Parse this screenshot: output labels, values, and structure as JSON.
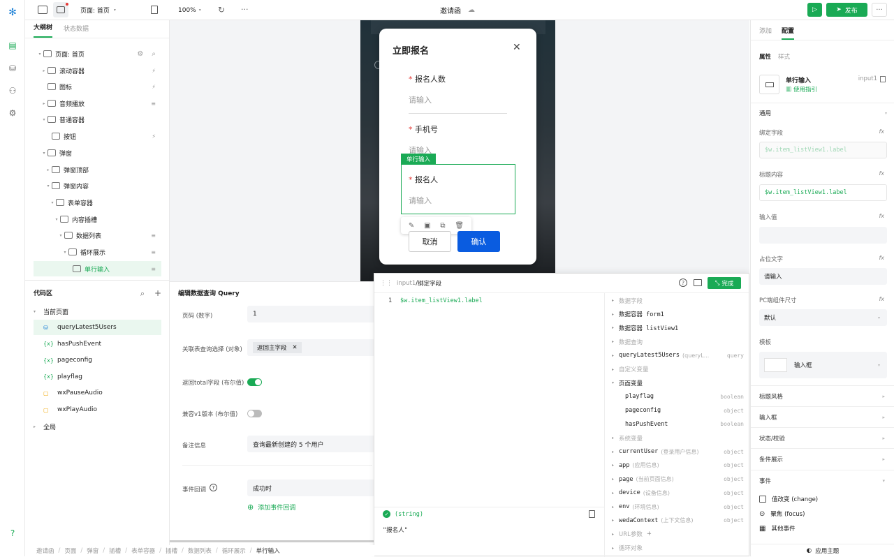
{
  "topbar": {
    "page_label": "页面: 首页",
    "zoom": "100%",
    "app_title": "邀请函",
    "publish_label": "发布"
  },
  "left": {
    "tabs": [
      "大纲树",
      "状态数据"
    ],
    "tree": [
      {
        "label": "页面: 首页",
        "indent": 0,
        "arrow": "▾"
      },
      {
        "label": "滚动容器",
        "indent": 1,
        "arrow": "▸"
      },
      {
        "label": "图标",
        "indent": 1,
        "arrow": ""
      },
      {
        "label": "音频播放",
        "indent": 1,
        "arrow": "▸"
      },
      {
        "label": "普通容器",
        "indent": 1,
        "arrow": "▾"
      },
      {
        "label": "按钮",
        "indent": 2,
        "arrow": ""
      },
      {
        "label": "弹窗",
        "indent": 1,
        "arrow": "▾"
      },
      {
        "label": "弹窗顶部",
        "indent": 2,
        "arrow": "▸"
      },
      {
        "label": "弹窗内容",
        "indent": 2,
        "arrow": "▾"
      },
      {
        "label": "表单容器",
        "indent": 3,
        "arrow": "▾"
      },
      {
        "label": "内容插槽",
        "indent": 4,
        "arrow": "▾"
      },
      {
        "label": "数据列表",
        "indent": 5,
        "arrow": "▾"
      },
      {
        "label": "循环展示",
        "indent": 6,
        "arrow": "▾"
      },
      {
        "label": "单行输入",
        "indent": 7,
        "arrow": ""
      }
    ],
    "code_title": "代码区",
    "code_group": "当前页面",
    "code_items": [
      "queryLatest5Users",
      "hasPushEvent",
      "pageconfig",
      "playflag",
      "wxPauseAudio",
      "wxPlayAudio"
    ],
    "code_icons": [
      "db",
      "{x}",
      "{x}",
      "{x}",
      "js",
      "js"
    ],
    "global": "全局"
  },
  "modal": {
    "title": "立即报名",
    "field1_label": "报名人数",
    "field1_ph": "请输入",
    "field2_label": "手机号",
    "field2_ph": "请输入",
    "badge": "单行输入",
    "field3_label": "报名人",
    "field3_ph": "请输入",
    "cancel": "取消",
    "confirm": "确认",
    "required": "*"
  },
  "editor": {
    "title": "编辑数据查询 Query",
    "rows": [
      {
        "label": "页码 (数字)",
        "value": "1"
      },
      {
        "label": "关联表查询选择 (对象)",
        "value": "返回主字段"
      },
      {
        "label": "返回total字段 (布尔值)",
        "value": ""
      },
      {
        "label": "兼容v1版本 (布尔值)",
        "value": ""
      },
      {
        "label": "备注信息",
        "value": "查询最新创建的 5 个用户"
      },
      {
        "label": "事件回调",
        "value": "成功时"
      }
    ],
    "add_event": "添加事件回调"
  },
  "bind": {
    "path_prefix": "input1",
    "path_title": "绑定字段",
    "done": "完成",
    "line_no": "1",
    "code": "$w.item_listView1.label",
    "result_type": "(string)",
    "result_value": "\"报名人\"",
    "vars": [
      {
        "kind": "group",
        "label": "数据字段"
      },
      {
        "kind": "item",
        "label": "数据容器 form1",
        "arrow": "▸"
      },
      {
        "kind": "item",
        "label": "数据容器 listView1",
        "arrow": "▸"
      },
      {
        "kind": "group",
        "label": "数据查询"
      },
      {
        "kind": "item",
        "label": "queryLatest5Users",
        "desc": "(queryL...",
        "type": "query",
        "arrow": "▸"
      },
      {
        "kind": "group",
        "label": "自定义变量"
      },
      {
        "kind": "item",
        "label": "页面变量",
        "arrow": "▾"
      },
      {
        "kind": "sub",
        "label": "playflag",
        "type": "boolean"
      },
      {
        "kind": "sub",
        "label": "pageconfig",
        "type": "object"
      },
      {
        "kind": "sub",
        "label": "hasPushEvent",
        "type": "boolean"
      },
      {
        "kind": "group",
        "label": "系统变量"
      },
      {
        "kind": "item",
        "label": "currentUser",
        "desc": "(登录用户信息)",
        "type": "object",
        "arrow": "▸"
      },
      {
        "kind": "item",
        "label": "app",
        "desc": "(应用信息)",
        "type": "object",
        "arrow": "▸"
      },
      {
        "kind": "item",
        "label": "page",
        "desc": "(当前页面信息)",
        "type": "object",
        "arrow": "▸"
      },
      {
        "kind": "item",
        "label": "device",
        "desc": "(设备信息)",
        "type": "object",
        "arrow": "▸"
      },
      {
        "kind": "item",
        "label": "env",
        "desc": "(环境信息)",
        "type": "object",
        "arrow": "▸"
      },
      {
        "kind": "item",
        "label": "wedaContext",
        "desc": "(上下文信息)",
        "type": "object",
        "arrow": "▸"
      },
      {
        "kind": "group",
        "label": "URL参数"
      },
      {
        "kind": "group",
        "label": "循环对象"
      }
    ]
  },
  "right": {
    "tabs": [
      "添加",
      "配置"
    ],
    "subtabs": [
      "属性",
      "样式"
    ],
    "comp_name": "单行输入",
    "comp_id": "input1",
    "guide": "使用指引",
    "general": "通用",
    "bind_label": "绑定字段",
    "bind_value": "$w.item_listView1.label",
    "title_label": "标题内容",
    "title_value": "$w.item_listView1.label",
    "input_label": "输入值",
    "ph_label": "占位文字",
    "ph_value": "请输入",
    "size_label": "PC端组件尺寸",
    "size_value": "默认",
    "tpl_label": "模板",
    "tpl_value": "输入框",
    "sections": [
      "标题风格",
      "输入框",
      "状态/校验",
      "条件展示"
    ],
    "events_label": "事件",
    "events": [
      "值改变 (change)",
      "聚焦 (focus)",
      "其他事件"
    ],
    "theme": "应用主题"
  },
  "crumbs": [
    "邀请函",
    "页面",
    "弹窗",
    "插槽",
    "表单容器",
    "插槽",
    "数据列表",
    "循环展示",
    "单行输入"
  ],
  "colors": {
    "accent": "#1aaa55",
    "primary": "#0a5ce0"
  }
}
